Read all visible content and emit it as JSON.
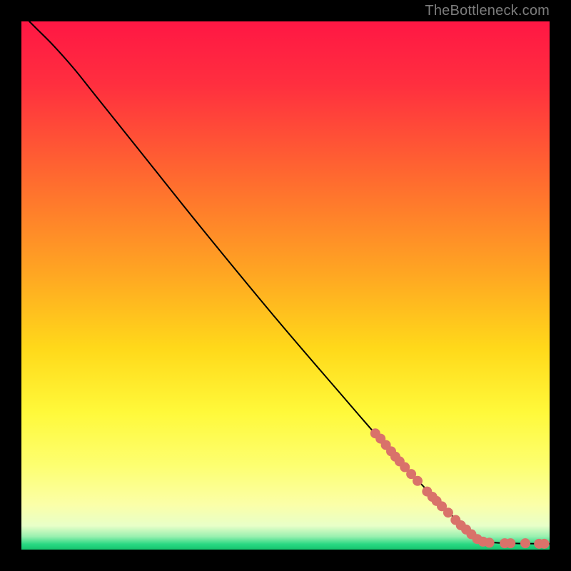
{
  "watermark": "TheBottleneck.com",
  "colors": {
    "frame": "#000000",
    "curve": "#000000",
    "marker": "#d9726a",
    "marker_stroke": "#c55b53",
    "gradient_stops": [
      {
        "offset": 0.0,
        "color": "#ff1744"
      },
      {
        "offset": 0.12,
        "color": "#ff2f3f"
      },
      {
        "offset": 0.3,
        "color": "#ff6b2f"
      },
      {
        "offset": 0.48,
        "color": "#ffa722"
      },
      {
        "offset": 0.62,
        "color": "#ffd91a"
      },
      {
        "offset": 0.74,
        "color": "#fff93a"
      },
      {
        "offset": 0.84,
        "color": "#fdff70"
      },
      {
        "offset": 0.915,
        "color": "#fbffa8"
      },
      {
        "offset": 0.955,
        "color": "#e8ffc8"
      },
      {
        "offset": 0.975,
        "color": "#9af0b0"
      },
      {
        "offset": 0.99,
        "color": "#28d882"
      },
      {
        "offset": 1.0,
        "color": "#16c46e"
      }
    ]
  },
  "chart_data": {
    "type": "line",
    "title": "",
    "xlabel": "",
    "ylabel": "",
    "xlim": [
      0,
      100
    ],
    "ylim": [
      0,
      100
    ],
    "curve": [
      {
        "x": 1.5,
        "y": 100
      },
      {
        "x": 3,
        "y": 98.5
      },
      {
        "x": 6,
        "y": 95.5
      },
      {
        "x": 10,
        "y": 91
      },
      {
        "x": 14,
        "y": 86
      },
      {
        "x": 22,
        "y": 76
      },
      {
        "x": 34,
        "y": 61
      },
      {
        "x": 48,
        "y": 44
      },
      {
        "x": 60,
        "y": 30
      },
      {
        "x": 70,
        "y": 18.5
      },
      {
        "x": 78,
        "y": 10
      },
      {
        "x": 83,
        "y": 5
      },
      {
        "x": 86,
        "y": 2.5
      },
      {
        "x": 88,
        "y": 1.5
      },
      {
        "x": 92,
        "y": 1.2
      },
      {
        "x": 100,
        "y": 1.1
      }
    ],
    "markers": [
      {
        "x": 67.0,
        "y": 22.0
      },
      {
        "x": 68.0,
        "y": 21.0
      },
      {
        "x": 69.0,
        "y": 19.8
      },
      {
        "x": 70.0,
        "y": 18.6
      },
      {
        "x": 70.8,
        "y": 17.6
      },
      {
        "x": 71.6,
        "y": 16.7
      },
      {
        "x": 72.6,
        "y": 15.6
      },
      {
        "x": 73.8,
        "y": 14.3
      },
      {
        "x": 75.0,
        "y": 13.0
      },
      {
        "x": 76.8,
        "y": 11.0
      },
      {
        "x": 77.8,
        "y": 10.0
      },
      {
        "x": 78.6,
        "y": 9.2
      },
      {
        "x": 79.6,
        "y": 8.2
      },
      {
        "x": 80.8,
        "y": 7.0
      },
      {
        "x": 82.2,
        "y": 5.6
      },
      {
        "x": 83.2,
        "y": 4.6
      },
      {
        "x": 84.2,
        "y": 3.8
      },
      {
        "x": 85.2,
        "y": 2.9
      },
      {
        "x": 86.3,
        "y": 2.0
      },
      {
        "x": 87.4,
        "y": 1.5
      },
      {
        "x": 88.6,
        "y": 1.3
      },
      {
        "x": 91.5,
        "y": 1.2
      },
      {
        "x": 92.6,
        "y": 1.2
      },
      {
        "x": 95.4,
        "y": 1.2
      },
      {
        "x": 98.0,
        "y": 1.1
      },
      {
        "x": 99.0,
        "y": 1.1
      }
    ]
  }
}
